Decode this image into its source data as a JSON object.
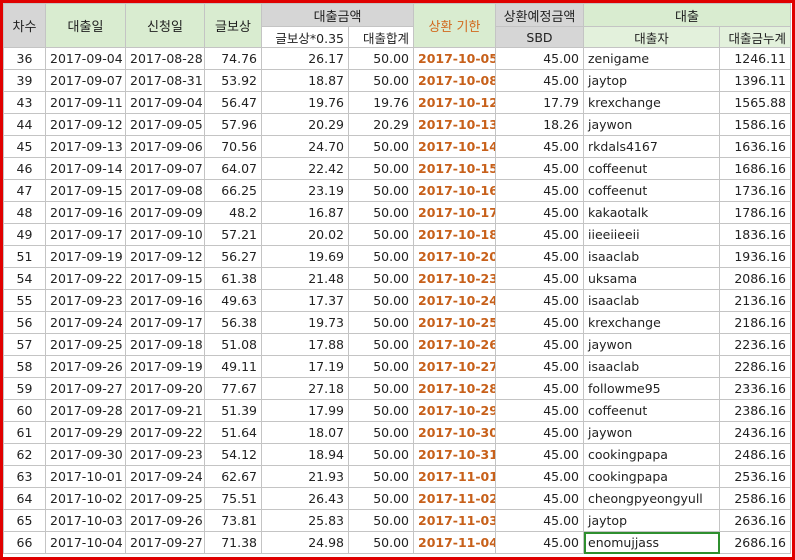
{
  "headers": {
    "round": "차수",
    "loan_date": "대출일",
    "apply_date": "신청일",
    "post_reward": "글보상",
    "loan_amount_group": "대출금액",
    "post_reward_x035": "글보상*0.35",
    "loan_total": "대출합계",
    "due_date": "상환 기한",
    "planned_repay_group": "상환예정금액",
    "sbd": "SBD",
    "loan_group": "대출",
    "borrower": "대출자",
    "loan_cumulative": "대출금누계"
  },
  "rows": [
    {
      "round": "36",
      "loan_date": "2017-09-04",
      "apply_date": "2017-08-28",
      "reward": "74.76",
      "reward035": "26.17",
      "total": "50.00",
      "due": "2017-10-05",
      "sbd": "45.00",
      "borrower": "zenigame",
      "cumulative": "1246.11"
    },
    {
      "round": "39",
      "loan_date": "2017-09-07",
      "apply_date": "2017-08-31",
      "reward": "53.92",
      "reward035": "18.87",
      "total": "50.00",
      "due": "2017-10-08",
      "sbd": "45.00",
      "borrower": "jaytop",
      "cumulative": "1396.11"
    },
    {
      "round": "43",
      "loan_date": "2017-09-11",
      "apply_date": "2017-09-04",
      "reward": "56.47",
      "reward035": "19.76",
      "total": "19.76",
      "due": "2017-10-12",
      "sbd": "17.79",
      "borrower": "krexchange",
      "cumulative": "1565.88"
    },
    {
      "round": "44",
      "loan_date": "2017-09-12",
      "apply_date": "2017-09-05",
      "reward": "57.96",
      "reward035": "20.29",
      "total": "20.29",
      "due": "2017-10-13",
      "sbd": "18.26",
      "borrower": "jaywon",
      "cumulative": "1586.16"
    },
    {
      "round": "45",
      "loan_date": "2017-09-13",
      "apply_date": "2017-09-06",
      "reward": "70.56",
      "reward035": "24.70",
      "total": "50.00",
      "due": "2017-10-14",
      "sbd": "45.00",
      "borrower": "rkdals4167",
      "cumulative": "1636.16"
    },
    {
      "round": "46",
      "loan_date": "2017-09-14",
      "apply_date": "2017-09-07",
      "reward": "64.07",
      "reward035": "22.42",
      "total": "50.00",
      "due": "2017-10-15",
      "sbd": "45.00",
      "borrower": "coffeenut",
      "cumulative": "1686.16"
    },
    {
      "round": "47",
      "loan_date": "2017-09-15",
      "apply_date": "2017-09-08",
      "reward": "66.25",
      "reward035": "23.19",
      "total": "50.00",
      "due": "2017-10-16",
      "sbd": "45.00",
      "borrower": "coffeenut",
      "cumulative": "1736.16"
    },
    {
      "round": "48",
      "loan_date": "2017-09-16",
      "apply_date": "2017-09-09",
      "reward": "48.2",
      "reward035": "16.87",
      "total": "50.00",
      "due": "2017-10-17",
      "sbd": "45.00",
      "borrower": "kakaotalk",
      "cumulative": "1786.16"
    },
    {
      "round": "49",
      "loan_date": "2017-09-17",
      "apply_date": "2017-09-10",
      "reward": "57.21",
      "reward035": "20.02",
      "total": "50.00",
      "due": "2017-10-18",
      "sbd": "45.00",
      "borrower": "iieeiieeii",
      "cumulative": "1836.16"
    },
    {
      "round": "51",
      "loan_date": "2017-09-19",
      "apply_date": "2017-09-12",
      "reward": "56.27",
      "reward035": "19.69",
      "total": "50.00",
      "due": "2017-10-20",
      "sbd": "45.00",
      "borrower": "isaaclab",
      "cumulative": "1936.16"
    },
    {
      "round": "54",
      "loan_date": "2017-09-22",
      "apply_date": "2017-09-15",
      "reward": "61.38",
      "reward035": "21.48",
      "total": "50.00",
      "due": "2017-10-23",
      "sbd": "45.00",
      "borrower": "uksama",
      "cumulative": "2086.16"
    },
    {
      "round": "55",
      "loan_date": "2017-09-23",
      "apply_date": "2017-09-16",
      "reward": "49.63",
      "reward035": "17.37",
      "total": "50.00",
      "due": "2017-10-24",
      "sbd": "45.00",
      "borrower": "isaaclab",
      "cumulative": "2136.16"
    },
    {
      "round": "56",
      "loan_date": "2017-09-24",
      "apply_date": "2017-09-17",
      "reward": "56.38",
      "reward035": "19.73",
      "total": "50.00",
      "due": "2017-10-25",
      "sbd": "45.00",
      "borrower": "krexchange",
      "cumulative": "2186.16"
    },
    {
      "round": "57",
      "loan_date": "2017-09-25",
      "apply_date": "2017-09-18",
      "reward": "51.08",
      "reward035": "17.88",
      "total": "50.00",
      "due": "2017-10-26",
      "sbd": "45.00",
      "borrower": "jaywon",
      "cumulative": "2236.16"
    },
    {
      "round": "58",
      "loan_date": "2017-09-26",
      "apply_date": "2017-09-19",
      "reward": "49.11",
      "reward035": "17.19",
      "total": "50.00",
      "due": "2017-10-27",
      "sbd": "45.00",
      "borrower": "isaaclab",
      "cumulative": "2286.16"
    },
    {
      "round": "59",
      "loan_date": "2017-09-27",
      "apply_date": "2017-09-20",
      "reward": "77.67",
      "reward035": "27.18",
      "total": "50.00",
      "due": "2017-10-28",
      "sbd": "45.00",
      "borrower": "followme95",
      "cumulative": "2336.16"
    },
    {
      "round": "60",
      "loan_date": "2017-09-28",
      "apply_date": "2017-09-21",
      "reward": "51.39",
      "reward035": "17.99",
      "total": "50.00",
      "due": "2017-10-29",
      "sbd": "45.00",
      "borrower": "coffeenut",
      "cumulative": "2386.16"
    },
    {
      "round": "61",
      "loan_date": "2017-09-29",
      "apply_date": "2017-09-22",
      "reward": "51.64",
      "reward035": "18.07",
      "total": "50.00",
      "due": "2017-10-30",
      "sbd": "45.00",
      "borrower": "jaywon",
      "cumulative": "2436.16"
    },
    {
      "round": "62",
      "loan_date": "2017-09-30",
      "apply_date": "2017-09-23",
      "reward": "54.12",
      "reward035": "18.94",
      "total": "50.00",
      "due": "2017-10-31",
      "sbd": "45.00",
      "borrower": "cookingpapa",
      "cumulative": "2486.16"
    },
    {
      "round": "63",
      "loan_date": "2017-10-01",
      "apply_date": "2017-09-24",
      "reward": "62.67",
      "reward035": "21.93",
      "total": "50.00",
      "due": "2017-11-01",
      "sbd": "45.00",
      "borrower": "cookingpapa",
      "cumulative": "2536.16"
    },
    {
      "round": "64",
      "loan_date": "2017-10-02",
      "apply_date": "2017-09-25",
      "reward": "75.51",
      "reward035": "26.43",
      "total": "50.00",
      "due": "2017-11-02",
      "sbd": "45.00",
      "borrower": "cheongpyeongyull",
      "cumulative": "2586.16"
    },
    {
      "round": "65",
      "loan_date": "2017-10-03",
      "apply_date": "2017-09-26",
      "reward": "73.81",
      "reward035": "25.83",
      "total": "50.00",
      "due": "2017-11-03",
      "sbd": "45.00",
      "borrower": "jaytop",
      "cumulative": "2636.16"
    },
    {
      "round": "66",
      "loan_date": "2017-10-04",
      "apply_date": "2017-09-27",
      "reward": "71.38",
      "reward035": "24.98",
      "total": "50.00",
      "due": "2017-11-04",
      "sbd": "45.00",
      "borrower": "enomujjass",
      "cumulative": "2686.16"
    }
  ],
  "selected_cell": {
    "row": 22,
    "column": "borrower"
  },
  "colors": {
    "frame": "#e00000",
    "header_gray": "#d6d6d6",
    "header_green": "#d9ecd0",
    "due_text": "#c7601a",
    "selection": "#2f8f2f"
  }
}
